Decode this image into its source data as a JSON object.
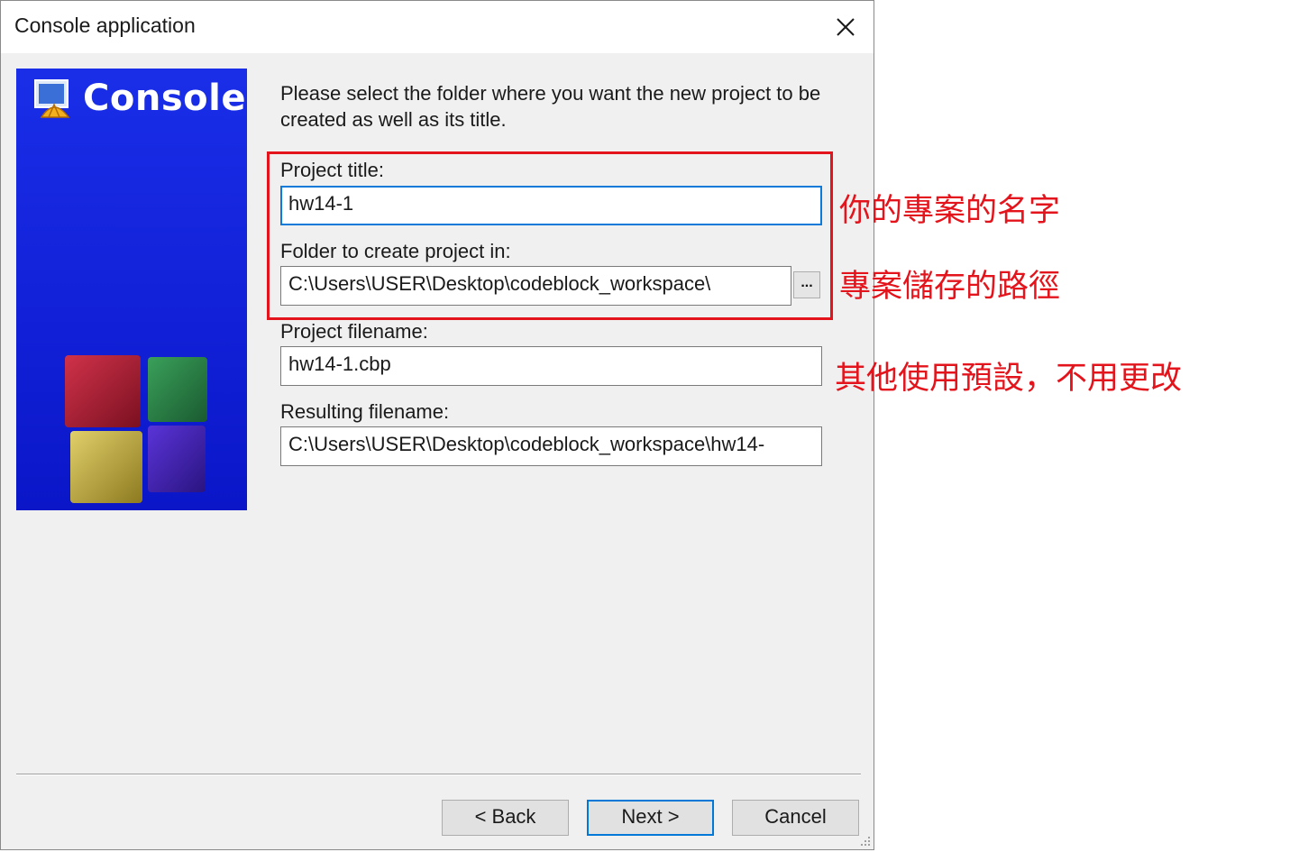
{
  "window": {
    "title": "Console application"
  },
  "banner": {
    "title": "Console"
  },
  "instructions": "Please select the folder where you want the new project to be created as well as its title.",
  "fields": {
    "project_title": {
      "label": "Project title:",
      "value": "hw14-1"
    },
    "folder": {
      "label": "Folder to create project in:",
      "value": "C:\\Users\\USER\\Desktop\\codeblock_workspace\\",
      "browse_label": "..."
    },
    "project_filename": {
      "label": "Project filename:",
      "value": "hw14-1.cbp"
    },
    "resulting_filename": {
      "label": "Resulting filename:",
      "value": "C:\\Users\\USER\\Desktop\\codeblock_workspace\\hw14-"
    }
  },
  "annotations": {
    "title_note": "你的專案的名字",
    "folder_note": "專案儲存的路徑",
    "default_note": "其他使用預設，不用更改"
  },
  "buttons": {
    "back": "< Back",
    "next": "Next >",
    "cancel": "Cancel"
  },
  "colors": {
    "annotation": "#e3141c",
    "banner_blue": "#1120d6",
    "focus": "#0b7ad9"
  }
}
